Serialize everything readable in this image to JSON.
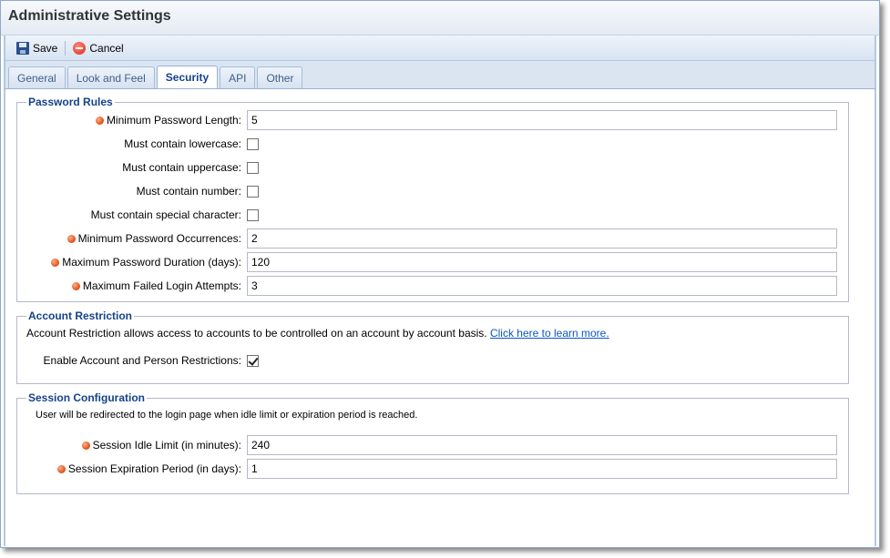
{
  "window": {
    "title": "Administrative Settings"
  },
  "toolbar": {
    "save_label": "Save",
    "cancel_label": "Cancel"
  },
  "tabs": [
    {
      "label": "General",
      "active": false
    },
    {
      "label": "Look and Feel",
      "active": false
    },
    {
      "label": "Security",
      "active": true
    },
    {
      "label": "API",
      "active": false
    },
    {
      "label": "Other",
      "active": false
    }
  ],
  "password_rules": {
    "legend": "Password Rules",
    "min_length": {
      "label": "Minimum Password Length:",
      "value": "5",
      "required": true
    },
    "lowercase": {
      "label": "Must contain lowercase:",
      "checked": false
    },
    "uppercase": {
      "label": "Must contain uppercase:",
      "checked": false
    },
    "number": {
      "label": "Must contain number:",
      "checked": false
    },
    "special": {
      "label": "Must contain special character:",
      "checked": false
    },
    "min_occurrences": {
      "label": "Minimum Password Occurrences:",
      "value": "2",
      "required": true
    },
    "max_duration": {
      "label": "Maximum Password Duration (days):",
      "value": "120",
      "required": true
    },
    "max_failed": {
      "label": "Maximum Failed Login Attempts:",
      "value": "3",
      "required": true
    }
  },
  "account_restriction": {
    "legend": "Account Restriction",
    "description": "Account Restriction allows access to accounts to be controlled on an account by account basis.",
    "link_text": "Click here to learn more.",
    "enable": {
      "label": "Enable Account and Person Restrictions:",
      "checked": true
    }
  },
  "session": {
    "legend": "Session Configuration",
    "description": "User will be redirected to the login page when idle limit or expiration period is reached.",
    "idle_limit": {
      "label": "Session Idle Limit (in minutes):",
      "value": "240",
      "required": true
    },
    "expiration": {
      "label": "Session Expiration Period (in days):",
      "value": "1",
      "required": true
    }
  },
  "colors": {
    "accent": "#15428b",
    "required_dot": "#e0521a",
    "link": "#0b57c4"
  }
}
